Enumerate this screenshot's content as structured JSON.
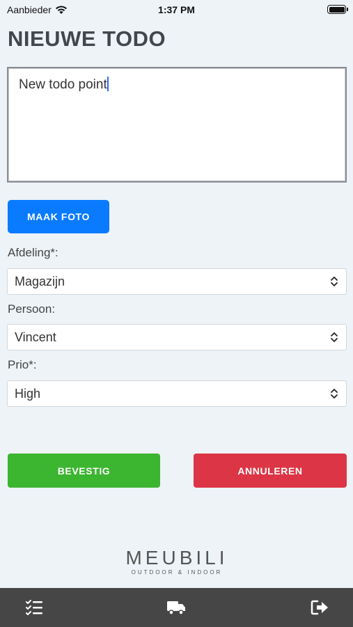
{
  "status": {
    "carrier": "Aanbieder",
    "time": "1:37 PM"
  },
  "title": "NIEUWE TODO",
  "todo_text": "New todo point",
  "photo_button": "MAAK FOTO",
  "fields": {
    "afdeling": {
      "label": "Afdeling*:",
      "value": "Magazijn"
    },
    "persoon": {
      "label": "Persoon:",
      "value": "Vincent"
    },
    "prio": {
      "label": "Prio*:",
      "value": "High"
    }
  },
  "buttons": {
    "confirm": "BEVESTIG",
    "cancel": "ANNULEREN"
  },
  "logo": {
    "name": "MEUBILI",
    "sub": "OUTDOOR & INDOOR"
  },
  "colors": {
    "primary": "#0a7bff",
    "confirm": "#3cb531",
    "cancel": "#dc3545",
    "nav": "#464646"
  },
  "nav_icons": [
    "checklist-icon",
    "delivery-truck-icon",
    "logout-icon"
  ]
}
